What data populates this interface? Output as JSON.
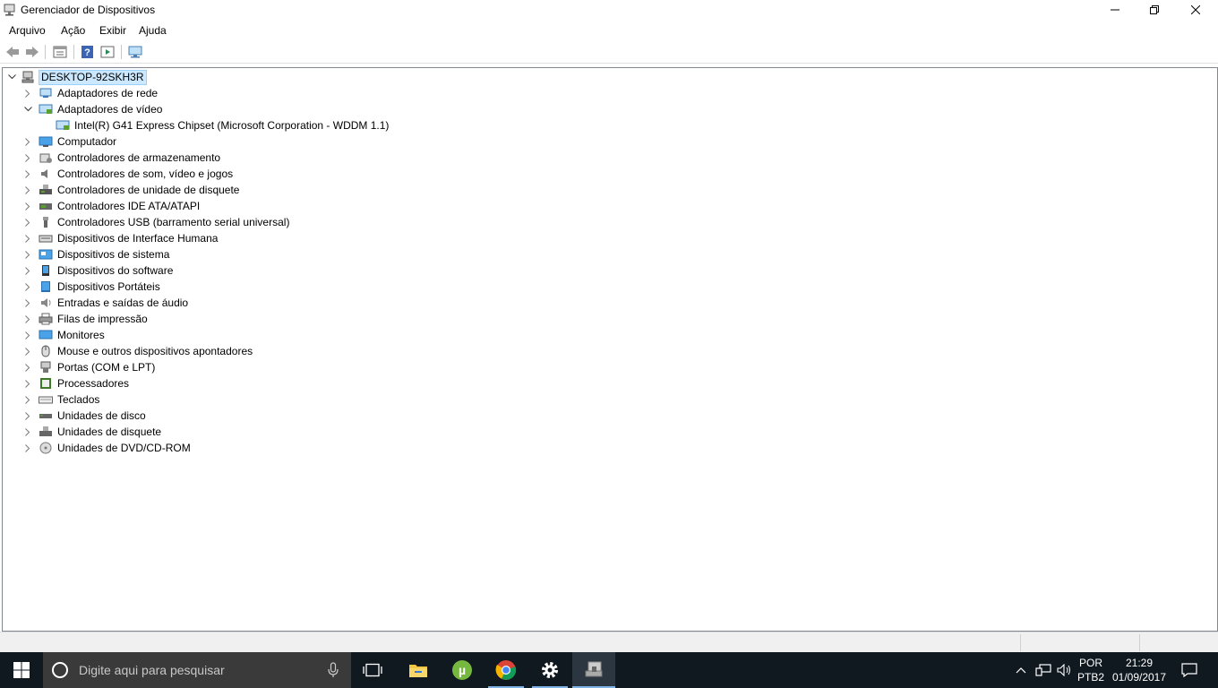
{
  "window": {
    "title": "Gerenciador de Dispositivos"
  },
  "menu": [
    "Arquivo",
    "Ação",
    "Exibir",
    "Ajuda"
  ],
  "tree": {
    "root": "DESKTOP-92SKH3R",
    "items": [
      {
        "label": "Adaptadores de rede",
        "icon": "network-adapter-icon",
        "expanded": false
      },
      {
        "label": "Adaptadores de vídeo",
        "icon": "display-adapter-icon",
        "expanded": true,
        "children": [
          "Intel(R) G41 Express Chipset (Microsoft Corporation - WDDM 1.1)"
        ]
      },
      {
        "label": "Computador",
        "icon": "computer-icon",
        "expanded": false
      },
      {
        "label": "Controladores de armazenamento",
        "icon": "storage-controller-icon",
        "expanded": false
      },
      {
        "label": "Controladores de som, vídeo e jogos",
        "icon": "sound-icon",
        "expanded": false
      },
      {
        "label": "Controladores de unidade de disquete",
        "icon": "floppy-controller-icon",
        "expanded": false
      },
      {
        "label": "Controladores IDE ATA/ATAPI",
        "icon": "ide-controller-icon",
        "expanded": false
      },
      {
        "label": "Controladores USB (barramento serial universal)",
        "icon": "usb-icon",
        "expanded": false
      },
      {
        "label": "Dispositivos de Interface Humana",
        "icon": "hid-icon",
        "expanded": false
      },
      {
        "label": "Dispositivos de sistema",
        "icon": "system-device-icon",
        "expanded": false
      },
      {
        "label": "Dispositivos do software",
        "icon": "software-device-icon",
        "expanded": false
      },
      {
        "label": "Dispositivos Portáteis",
        "icon": "portable-device-icon",
        "expanded": false
      },
      {
        "label": "Entradas e saídas de áudio",
        "icon": "audio-io-icon",
        "expanded": false
      },
      {
        "label": "Filas de impressão",
        "icon": "printer-icon",
        "expanded": false
      },
      {
        "label": "Monitores",
        "icon": "monitor-icon",
        "expanded": false
      },
      {
        "label": "Mouse e outros dispositivos apontadores",
        "icon": "mouse-icon",
        "expanded": false
      },
      {
        "label": "Portas (COM e LPT)",
        "icon": "port-icon",
        "expanded": false
      },
      {
        "label": "Processadores",
        "icon": "processor-icon",
        "expanded": false
      },
      {
        "label": "Teclados",
        "icon": "keyboard-icon",
        "expanded": false
      },
      {
        "label": "Unidades de disco",
        "icon": "disk-drive-icon",
        "expanded": false
      },
      {
        "label": "Unidades de disquete",
        "icon": "floppy-drive-icon",
        "expanded": false
      },
      {
        "label": "Unidades de DVD/CD-ROM",
        "icon": "dvd-icon",
        "expanded": false
      }
    ]
  },
  "taskbar": {
    "search_placeholder": "Digite aqui para pesquisar",
    "lang_top": "POR",
    "lang_bottom": "PTB2",
    "time": "21:29",
    "date": "01/09/2017"
  },
  "colors": {
    "selection": "#cce8ff",
    "taskbar": "#101820",
    "accent": "#0078d7"
  }
}
